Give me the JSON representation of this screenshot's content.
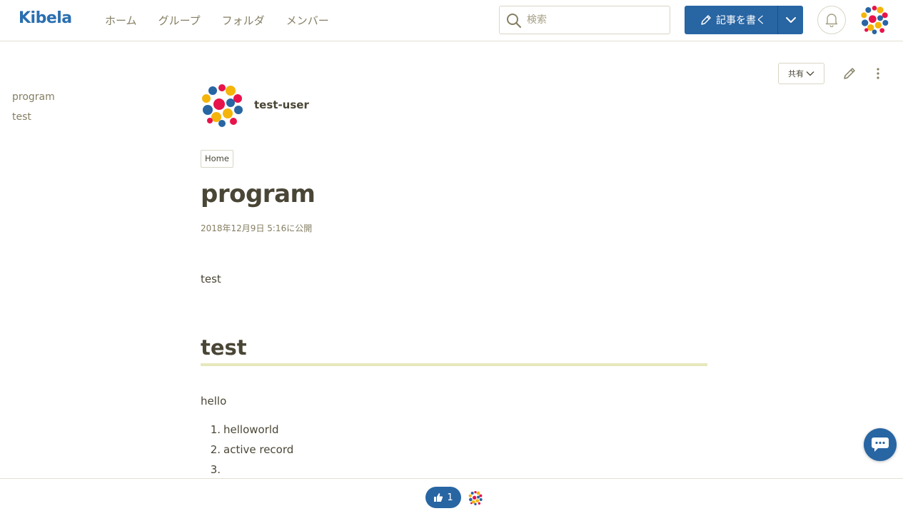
{
  "header": {
    "logo": "Kibela",
    "nav": [
      "ホーム",
      "グループ",
      "フォルダ",
      "メンバー"
    ],
    "search_placeholder": "検索",
    "write_label": "記事を書く"
  },
  "sidebar": {
    "toc": [
      "program",
      "test"
    ]
  },
  "actions": {
    "share_label": "共有"
  },
  "article": {
    "author": "test-user",
    "folder": "Home",
    "title": "program",
    "published": "2018年12月9日 5:16に公開",
    "p1": "test",
    "heading2": "test",
    "p2": "hello",
    "list": [
      {
        "num": "1.",
        "text": "helloworld"
      },
      {
        "num": "2.",
        "text": "active record"
      },
      {
        "num": "3.",
        "text": ""
      }
    ]
  },
  "footer": {
    "like_count": "1"
  },
  "colors": {
    "primary": "#2865a3",
    "text": "#4a4636",
    "muted": "#847e62",
    "heading_rule": "#e6e8bd",
    "avatar_red": "#e8134b",
    "avatar_blue": "#2865a3",
    "avatar_yellow": "#f5b40a"
  }
}
